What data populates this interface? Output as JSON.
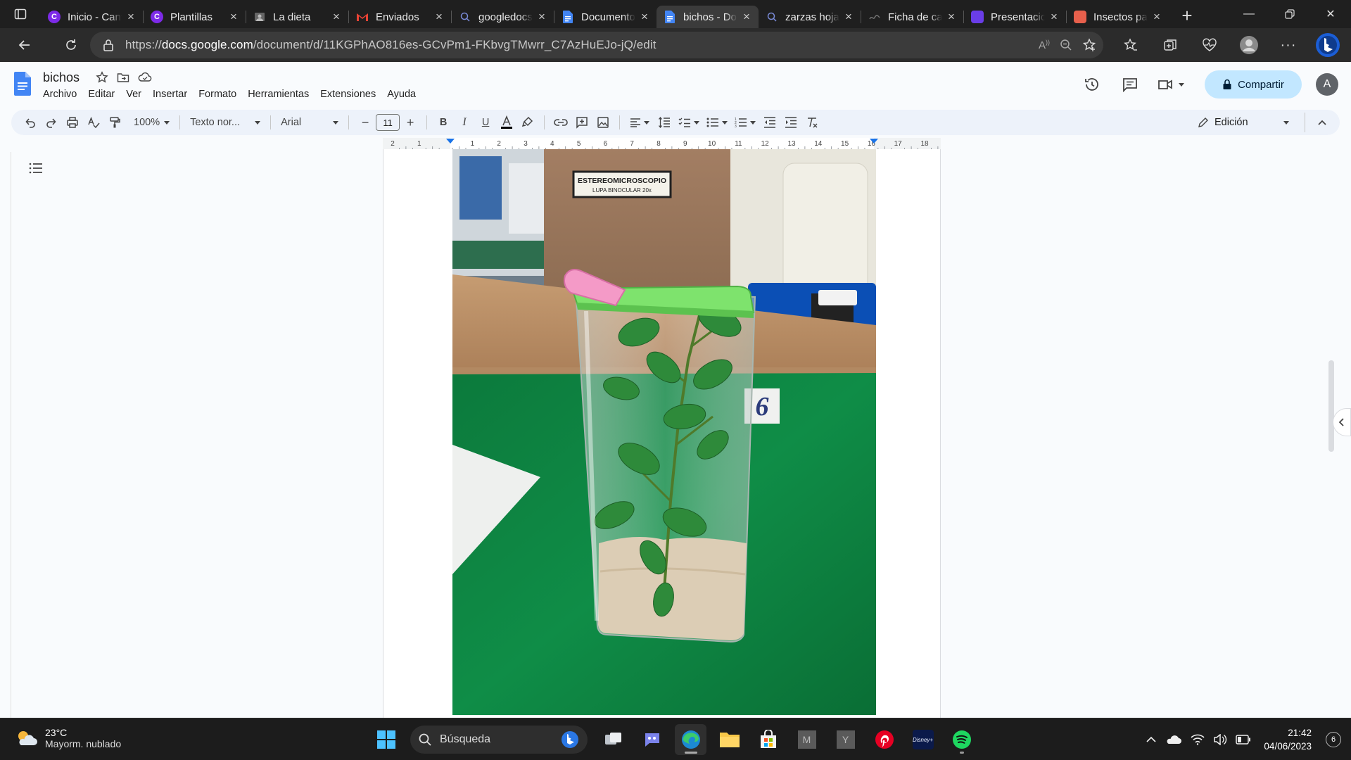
{
  "browser": {
    "tabs": [
      {
        "title": "Inicio - Canva",
        "icon": "canva-icon",
        "color": "#7d2ae8",
        "glyph": "C"
      },
      {
        "title": "Plantillas",
        "icon": "canva-icon",
        "color": "#7d2ae8",
        "glyph": "C"
      },
      {
        "title": "La dieta",
        "icon": "image-icon",
        "color": "#555555",
        "glyph": ""
      },
      {
        "title": "Enviados",
        "icon": "gmail-icon",
        "color": "#ffffff",
        "glyph": "M"
      },
      {
        "title": "googledocs",
        "icon": "search-icon",
        "color": "#1f1f1f",
        "glyph": ""
      },
      {
        "title": "Documentos",
        "icon": "docs-icon",
        "color": "#4285f4",
        "glyph": ""
      },
      {
        "title": "bichos - Documentos",
        "icon": "docs-icon",
        "color": "#4285f4",
        "glyph": "",
        "active": true
      },
      {
        "title": "zarzas hoja",
        "icon": "search-icon",
        "color": "#1f1f1f",
        "glyph": ""
      },
      {
        "title": "Ficha de campo",
        "icon": "generic-icon",
        "color": "#1f1f1f",
        "glyph": ""
      },
      {
        "title": "Presentaciones",
        "icon": "app-icon",
        "color": "#6a3de8",
        "glyph": ""
      },
      {
        "title": "Insectos para",
        "icon": "app-icon",
        "color": "#e8604c",
        "glyph": ""
      }
    ],
    "url_prefix": "https://",
    "url_host": "docs.google.com",
    "url_path": "/document/d/11KGPhAO816es-GCvPm1-FKbvgTMwrr_C7AzHuEJo-jQ/edit"
  },
  "docs": {
    "title": "bichos",
    "menu": [
      "Archivo",
      "Editar",
      "Ver",
      "Insertar",
      "Formato",
      "Herramientas",
      "Extensiones",
      "Ayuda"
    ],
    "share_label": "Compartir",
    "avatar_letter": "A",
    "toolbar": {
      "zoom": "100%",
      "style": "Texto nor...",
      "font": "Arial",
      "font_size": "11",
      "mode": "Edición"
    },
    "ruler_ticks": [
      "2",
      "1",
      "",
      "1",
      "2",
      "3",
      "4",
      "5",
      "6",
      "7",
      "8",
      "9",
      "10",
      "11",
      "12",
      "13",
      "14",
      "15",
      "16",
      "17",
      "18"
    ]
  },
  "photo": {
    "sign_line1": "ESTEREOMICROSCOPIO",
    "sign_line2": "LUPA BINOCULAR 20x",
    "number": "6"
  },
  "taskbar": {
    "temperature": "23°C",
    "condition": "Mayorm. nublado",
    "search_placeholder": "Búsqueda",
    "time": "21:42",
    "date": "04/06/2023",
    "notifications": "6"
  },
  "colors": {
    "accent": "#c2e7ff",
    "docs_blue": "#4285f4",
    "table_green": "#0e8a45"
  }
}
